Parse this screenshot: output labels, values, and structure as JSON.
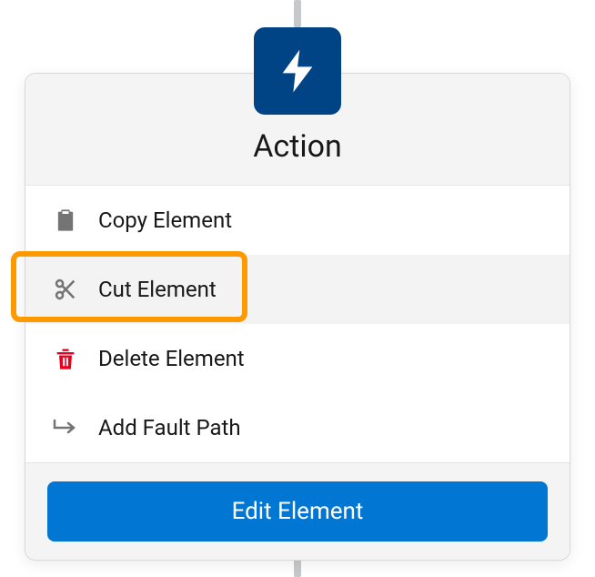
{
  "action": {
    "title": "Action"
  },
  "menu": {
    "copy": "Copy Element",
    "cut": "Cut Element",
    "delete": "Delete Element",
    "addFault": "Add Fault Path"
  },
  "footer": {
    "editButton": "Edit Element"
  }
}
